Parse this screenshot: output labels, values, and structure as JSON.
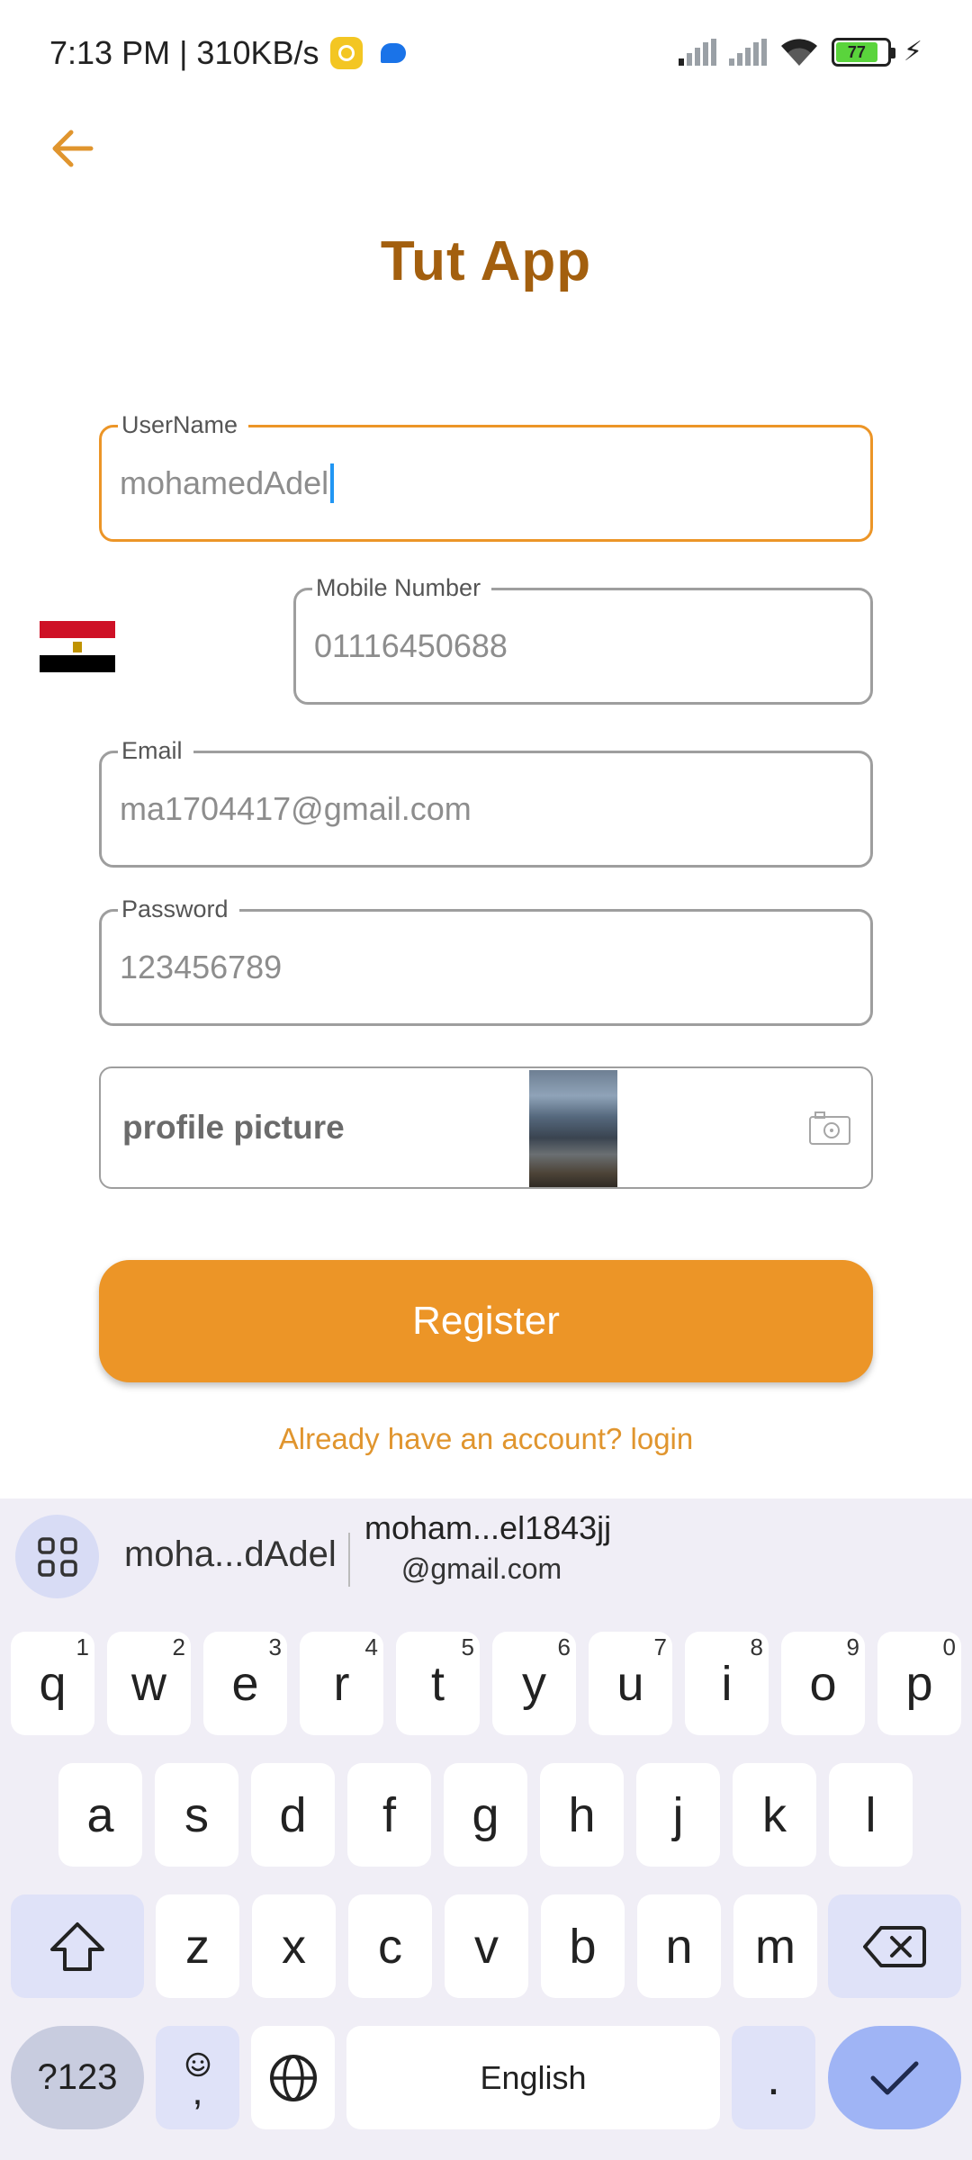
{
  "status_bar": {
    "time_speed": "7:13 PM | 310KB/s",
    "battery_level": "77"
  },
  "app": {
    "title": "Tut App"
  },
  "form": {
    "username_label": "UserName",
    "username_value": "mohamedAdel",
    "mobile_label": "Mobile Number",
    "mobile_value": "01116450688",
    "email_label": "Email",
    "email_value": "ma1704417@gmail.com",
    "password_label": "Password",
    "password_value": "123456789",
    "profile_label": "profile picture",
    "register_label": "Register",
    "login_link": "Already have an account? login"
  },
  "colors": {
    "accent": "#ec9527",
    "title": "#a35f0e",
    "link": "#e0952e"
  },
  "keyboard": {
    "suggestion_1": "moha...dAdel",
    "suggestion_2_line1": "moham...el1843jj",
    "suggestion_2_line2": "@gmail.com",
    "row1": [
      "q",
      "w",
      "e",
      "r",
      "t",
      "y",
      "u",
      "i",
      "o",
      "p"
    ],
    "row1_hints": [
      "1",
      "2",
      "3",
      "4",
      "5",
      "6",
      "7",
      "8",
      "9",
      "0"
    ],
    "row2": [
      "a",
      "s",
      "d",
      "f",
      "g",
      "h",
      "j",
      "k",
      "l"
    ],
    "row3": [
      "z",
      "x",
      "c",
      "v",
      "b",
      "n",
      "m"
    ],
    "symbols_label": "?123",
    "emoji_comma_label": ",",
    "space_label": "English",
    "period_label": "."
  }
}
